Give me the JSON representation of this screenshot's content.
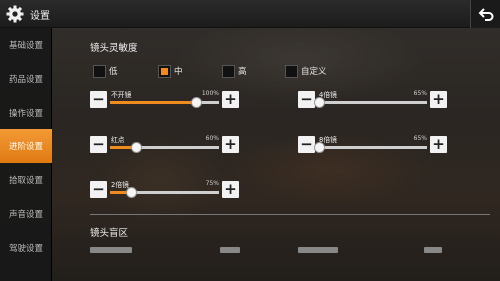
{
  "header": {
    "title": "设置",
    "icon": "gear-icon",
    "back_icon": "return-arrow-icon"
  },
  "sidebar": {
    "items": [
      {
        "label": "基础设置",
        "active": false
      },
      {
        "label": "药品设置",
        "active": false
      },
      {
        "label": "操作设置",
        "active": false
      },
      {
        "label": "进阶设置",
        "active": true
      },
      {
        "label": "拾取设置",
        "active": false
      },
      {
        "label": "声音设置",
        "active": false
      },
      {
        "label": "驾驶设置",
        "active": false
      }
    ]
  },
  "sensitivity": {
    "title": "镜头灵敏度",
    "options": [
      {
        "label": "低",
        "checked": false
      },
      {
        "label": "中",
        "checked": true
      },
      {
        "label": "高",
        "checked": false
      },
      {
        "label": "自定义",
        "checked": false
      }
    ]
  },
  "sliders": [
    {
      "label": "不开镜",
      "value": "100%",
      "fraction": 0.79
    },
    {
      "label": "4倍镜",
      "value": "65%",
      "fraction": 0.01
    },
    {
      "label": "红点",
      "value": "60%",
      "fraction": 0.24
    },
    {
      "label": "8倍镜",
      "value": "65%",
      "fraction": 0.01
    },
    {
      "label": "2倍镜",
      "value": "75%",
      "fraction": 0.19
    }
  ],
  "controls": {
    "minus": "−",
    "plus": "+"
  },
  "aim_zone": {
    "title": "镜头盲区"
  },
  "colors": {
    "accent": "#f08c1e",
    "sidebar_bg": "#181818",
    "button_bg": "#f2f2f2"
  }
}
